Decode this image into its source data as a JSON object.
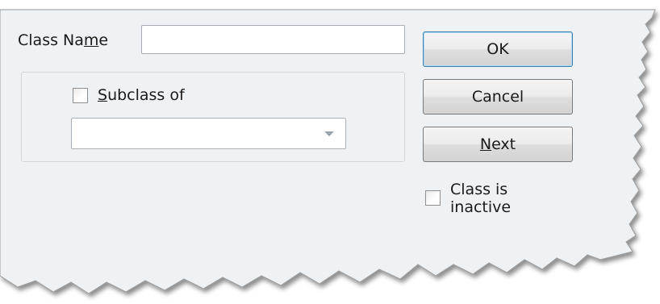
{
  "dialog": {
    "class_name_label_pre": "Class Na",
    "class_name_label_u": "m",
    "class_name_label_post": "e",
    "class_name_value": "",
    "subclass_label_u": "S",
    "subclass_label_rest": "ubclass of",
    "subclass_checked": false,
    "subclass_selected": "",
    "inactive_checked": false,
    "inactive_line1": "Class is",
    "inactive_line2": "inactive"
  },
  "buttons": {
    "ok_label": "OK",
    "cancel_label": "Cancel",
    "next_u": "N",
    "next_rest": "ext"
  },
  "colors": {
    "dialog_bg": "#eff2f4",
    "default_button_border": "#3c7fb1"
  }
}
